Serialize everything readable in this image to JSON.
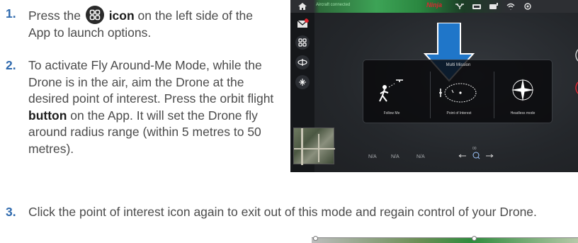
{
  "steps": [
    {
      "number": "1.",
      "text_a": "Press the",
      "icon": "multi-mission-icon",
      "bold": "icon",
      "text_b": "on the left side of the App to launch options."
    },
    {
      "number": "2.",
      "text_a": "To activate Fly Around-Me Mode, while the Drone is in the air, aim the Drone at the desired point of interest. Press the orbit flight",
      "bold": "button",
      "text_b": "on the App. It will set the Drone fly around radius range (within 5 metres to 50 metres)."
    },
    {
      "number": "3.",
      "text": "Click the point of interest icon again to exit out of this mode and regain control of your Drone."
    }
  ],
  "app": {
    "status": "Aircraft connected",
    "brand": "Ninja",
    "mission_title": "Multi Mission",
    "cards": [
      "Follow Me",
      "Point of Interest",
      "Headless mode"
    ],
    "telemetry": [
      "N/A",
      "N/A",
      "N/A"
    ],
    "joystick_value": "00",
    "colors": {
      "arrow": "#1f76c9",
      "topbar_green": "#3da356",
      "step_number": "#2e69ad",
      "brand_red": "#e0242f"
    },
    "icons": [
      "home-icon",
      "mail-icon",
      "multi-mission-icon",
      "orbit-icon",
      "landing-icon",
      "drone-icon",
      "signal-icon",
      "battery-icon",
      "wifi-icon",
      "camera-icon",
      "arrow-down-icon",
      "compass-icon"
    ]
  }
}
